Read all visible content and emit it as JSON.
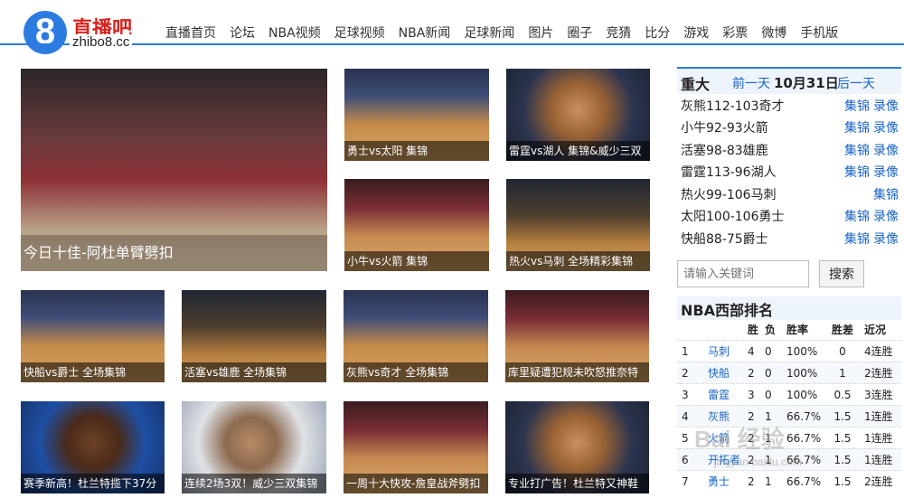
{
  "header": {
    "logo_digit": "8",
    "brand_cn": "直播吧",
    "brand_en": "zhibo8.cc",
    "accent": "#2c7be0",
    "nav": [
      "直播首页",
      "论坛",
      "NBA视频",
      "足球视频",
      "NBA新闻",
      "足球新闻",
      "图片",
      "圈子",
      "竞猜",
      "比分",
      "游戏",
      "彩票",
      "微博",
      "手机版"
    ]
  },
  "videos": {
    "big": "今日十佳-阿杜单臂劈扣",
    "row1": [
      "勇士vs太阳 集锦",
      "雷霆vs湖人 集锦&威少三双",
      "小牛vs火箭 集锦",
      "热火vs马刺 全场精彩集锦"
    ],
    "row2": [
      "快船vs爵士 全场集锦",
      "活塞vs雄鹿 全场集锦",
      "灰熊vs奇才 全场集锦",
      "库里疑遭犯规未吹怒推奈特"
    ],
    "row3": [
      "赛季新高！杜兰特揽下37分",
      "连续2场3双！威少三双集锦",
      "一周十大快攻-詹皇战斧劈扣",
      "专业打广告！杜兰特又神鞋"
    ]
  },
  "sidebar": {
    "title": "重大",
    "prev_day": "前一天",
    "date": "10月31日",
    "next_day": "后一天",
    "games": [
      {
        "score": "灰熊112-103奇才",
        "highlight": "集锦",
        "replay": "录像"
      },
      {
        "score": "小牛92-93火箭",
        "highlight": "集锦",
        "replay": "录像"
      },
      {
        "score": "活塞98-83雄鹿",
        "highlight": "集锦",
        "replay": "录像"
      },
      {
        "score": "雷霆113-96湖人",
        "highlight": "集锦",
        "replay": "录像"
      },
      {
        "score": "热火99-106马刺",
        "highlight": "集锦",
        "replay": ""
      },
      {
        "score": "太阳100-106勇士",
        "highlight": "集锦",
        "replay": "录像"
      },
      {
        "score": "快船88-75爵士",
        "highlight": "集锦",
        "replay": "录像"
      }
    ],
    "search_placeholder": "请输入关键词",
    "search_button": "搜索"
  },
  "ranking": {
    "title": "NBA西部排名",
    "columns": [
      "胜",
      "负",
      "胜率",
      "胜差",
      "近况"
    ],
    "rows": [
      [
        "1",
        "马刺",
        "4",
        "0",
        "100%",
        "0",
        "4连胜"
      ],
      [
        "2",
        "快船",
        "2",
        "0",
        "100%",
        "1",
        "2连胜"
      ],
      [
        "3",
        "雷霆",
        "3",
        "0",
        "100%",
        "0.5",
        "3连胜"
      ],
      [
        "4",
        "灰熊",
        "2",
        "1",
        "66.7%",
        "1.5",
        "1连胜"
      ],
      [
        "5",
        "火箭",
        "2",
        "1",
        "66.7%",
        "1.5",
        "1连胜"
      ],
      [
        "6",
        "开拓者",
        "2",
        "1",
        "66.7%",
        "1.5",
        "1连胜"
      ],
      [
        "7",
        "勇士",
        "2",
        "1",
        "66.7%",
        "1.5",
        "2连胜"
      ]
    ]
  },
  "watermark": {
    "main": "Bai 经验",
    "sub": "jingyan.baidu.com"
  }
}
